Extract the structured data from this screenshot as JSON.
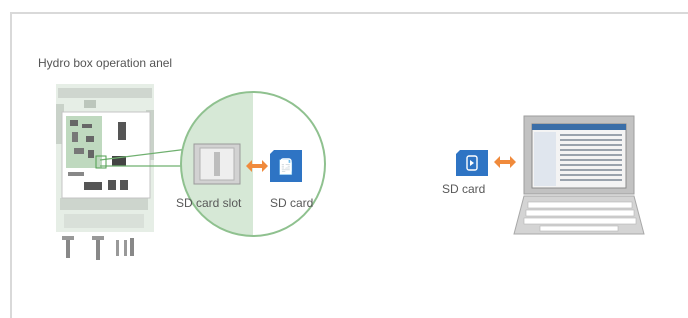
{
  "diagram": {
    "title": "Hydro box operation anel",
    "labels": {
      "sd_card_slot": "SD card slot",
      "sd_card_left": "SD card",
      "sd_card_right": "SD card"
    },
    "colors": {
      "panel_green": "#d6e8d6",
      "zoom_green_border": "#8fc18f",
      "sd_card_blue": "#2e74c4",
      "arrow_orange": "#f08a3c",
      "device_gray": "#c8c8c8",
      "screen_blue": "#3a6ea8"
    }
  }
}
